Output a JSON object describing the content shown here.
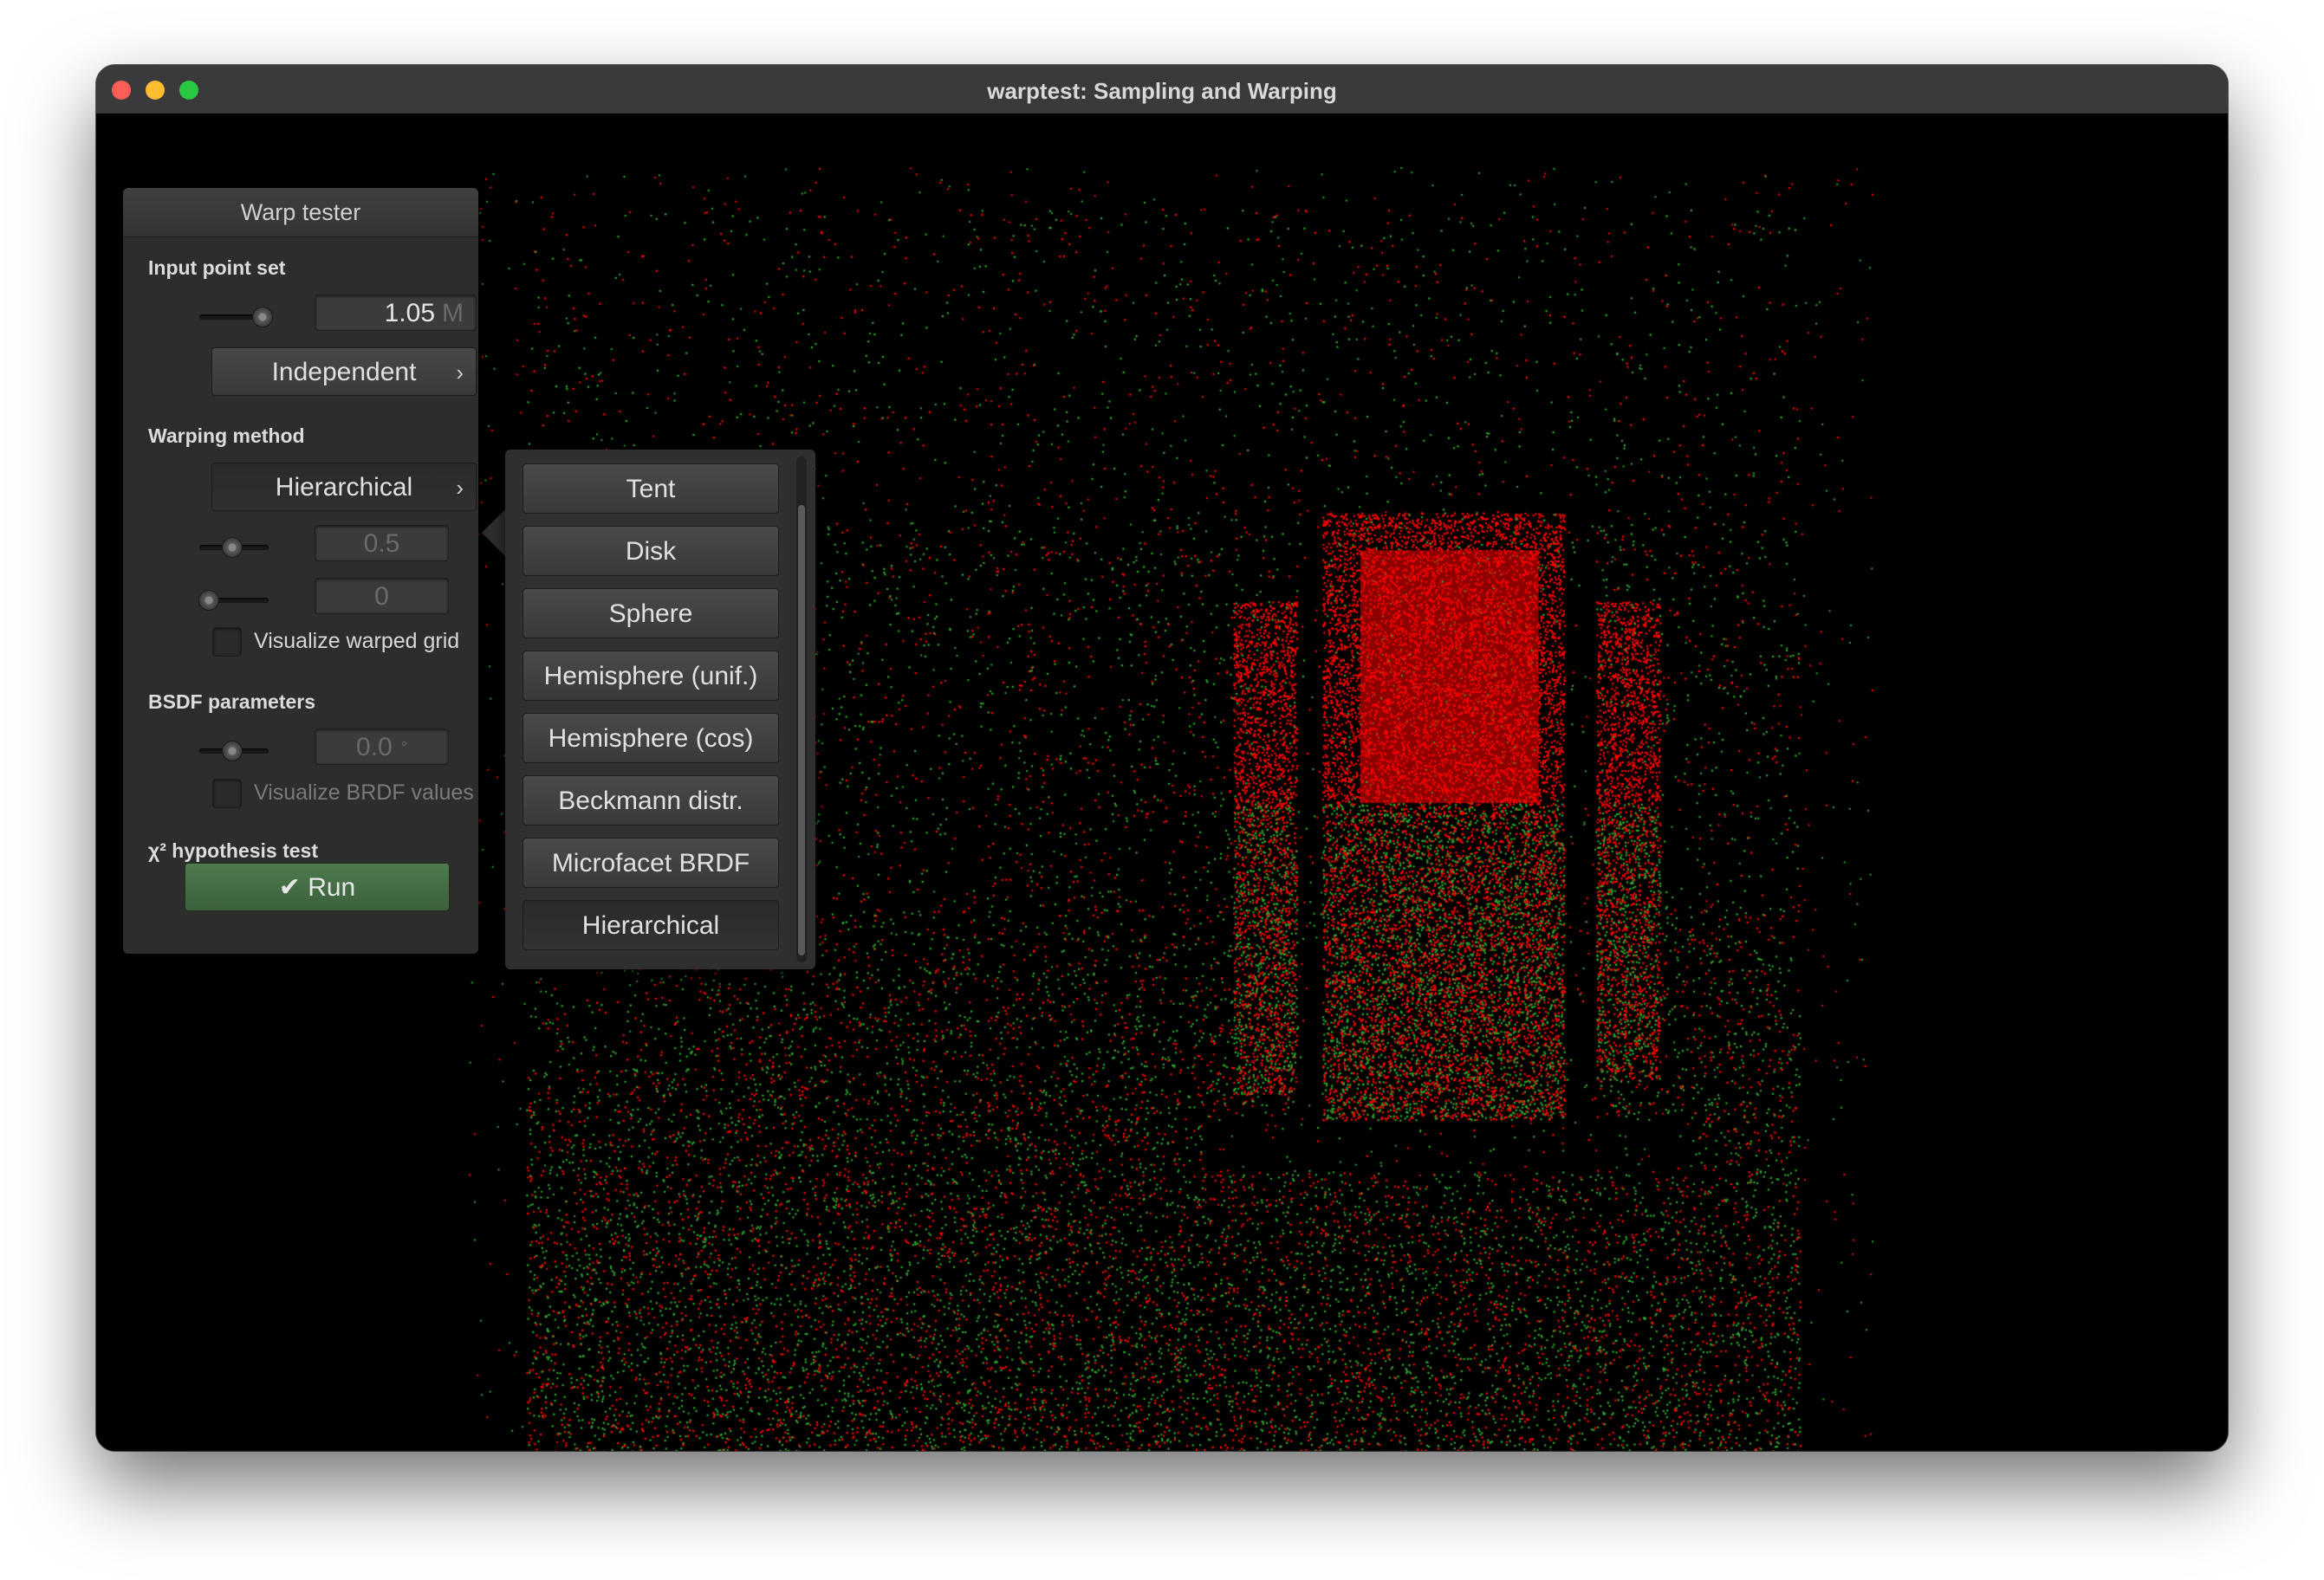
{
  "window": {
    "title": "warptest: Sampling and Warping"
  },
  "panel": {
    "title": "Warp tester",
    "input_point_set": {
      "label": "Input point set",
      "point_count_value": "1.05",
      "point_count_unit": "M",
      "point_count_slider_level": 0.95,
      "generator_button": "Independent"
    },
    "warping_method": {
      "label": "Warping method",
      "method_button": "Hierarchical",
      "param1_value": "0.5",
      "param1_slider_level": 0.5,
      "param2_value": "0",
      "param2_slider_level": 0.0,
      "visualize_grid_label": "Visualize warped grid",
      "visualize_grid_checked": false
    },
    "bsdf_parameters": {
      "label": "BSDF parameters",
      "angle_value": "0.0",
      "angle_unit": "°",
      "angle_slider_level": 0.5,
      "visualize_brdf_label": "Visualize BRDF values",
      "visualize_brdf_checked": false
    },
    "hypothesis_test": {
      "label": "χ² hypothesis test",
      "run_button": "✔ Run"
    }
  },
  "method_popup": {
    "items": [
      "Tent",
      "Disk",
      "Sphere",
      "Hemisphere (unif.)",
      "Hemisphere (cos)",
      "Beckmann distr.",
      "Microfacet BRDF",
      "Hierarchical"
    ],
    "selected": "Hierarchical"
  },
  "colors": {
    "point_red": "#ff0000",
    "point_green": "#2fa82f",
    "run_button": "#4e7a4e",
    "background": "#000000"
  }
}
